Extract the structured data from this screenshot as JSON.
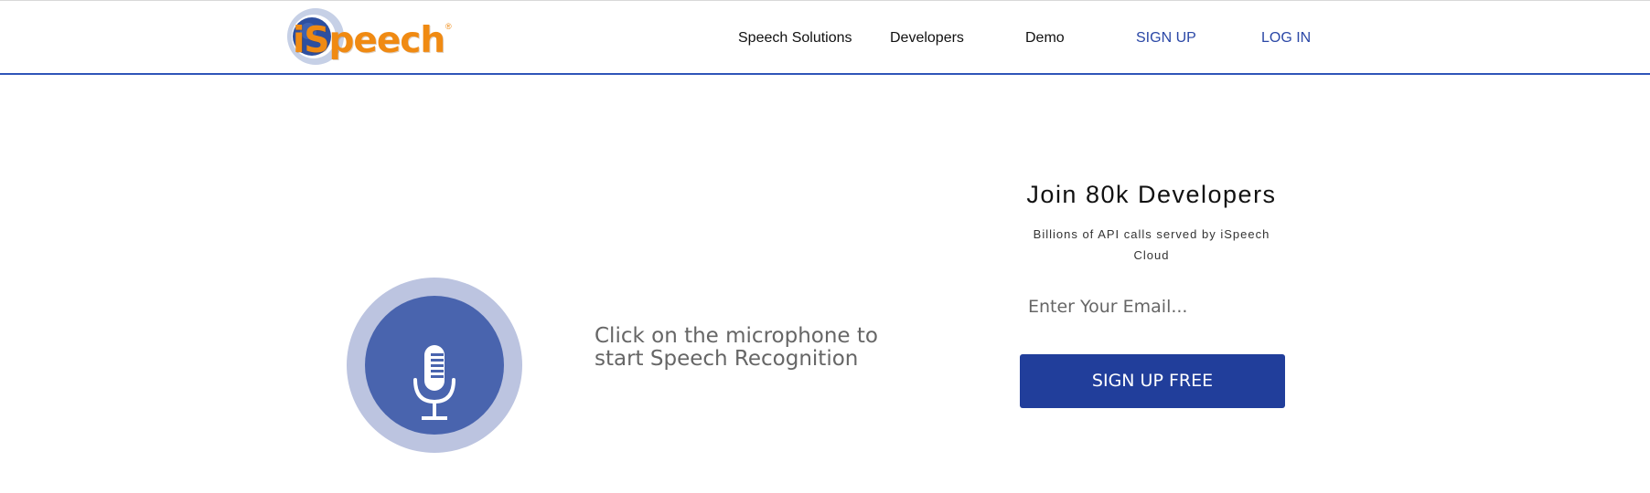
{
  "header": {
    "logo_text": "iSpeech",
    "logo_mark": "®",
    "nav": [
      {
        "label": "Speech Solutions"
      },
      {
        "label": "Developers"
      },
      {
        "label": "Demo"
      },
      {
        "label": "SIGN UP"
      },
      {
        "label": "LOG IN"
      }
    ]
  },
  "recognition": {
    "icon": "microphone-icon",
    "prompt": "Click on the microphone to start Speech Recognition"
  },
  "signup": {
    "title": "Join 80k Developers",
    "subtitle": "Billions of API calls served by iSpeech Cloud",
    "email_placeholder": "Enter Your Email...",
    "button_label": "SIGN UP FREE"
  },
  "colors": {
    "brand_orange": "#f08a12",
    "brand_blue": "#213e9b",
    "nav_link_blue": "#2a47a6",
    "mic_outer": "#bcc4e0",
    "mic_inner": "#4964ae",
    "header_border": "#2f55b8"
  }
}
